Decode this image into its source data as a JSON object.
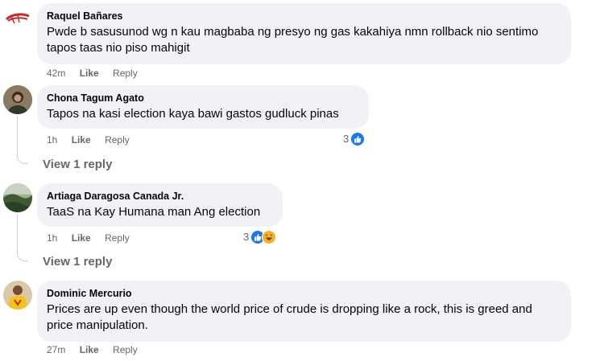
{
  "comments": [
    {
      "author": "Raquel Bañares",
      "text": "Pwde b sasusunod wg n kau magbaba ng presyo ng gas kakahiya nmn rollback nio sentimo tapos taas nio piso mahigit",
      "time": "42m",
      "like_label": "Like",
      "reply_label": "Reply",
      "avatar_icon": "red-swoosh-avatar"
    },
    {
      "author": "Chona Tagum Agato",
      "text": "Tapos na kasi election kaya bawi gastos gudluck pinas",
      "time": "1h",
      "like_label": "Like",
      "reply_label": "Reply",
      "reaction_count": "3",
      "reaction_icons": [
        "like-icon"
      ],
      "view_replies": "View 1 reply",
      "avatar_icon": "profile-photo-avatar"
    },
    {
      "author": "Artiaga Daragosa Canada Jr.",
      "text": "TaaS na Kay Humana man Ang election",
      "time": "1h",
      "like_label": "Like",
      "reply_label": "Reply",
      "reaction_count": "3",
      "reaction_icons": [
        "like-icon",
        "haha-icon"
      ],
      "view_replies": "View 1 reply",
      "avatar_icon": "landscape-avatar"
    },
    {
      "author": "Dominic Mercurio",
      "text": "Prices are up even though the world price of crude is dropping like a rock, this is greed and price manipulation.",
      "time": "27m",
      "like_label": "Like",
      "reply_label": "Reply",
      "avatar_icon": "yellow-jersey-avatar"
    }
  ],
  "colors": {
    "bubble": "#f0f2f5",
    "secondary_text": "#65676b",
    "like_blue": "#1877f2",
    "haha_yellow": "#f7b125"
  }
}
